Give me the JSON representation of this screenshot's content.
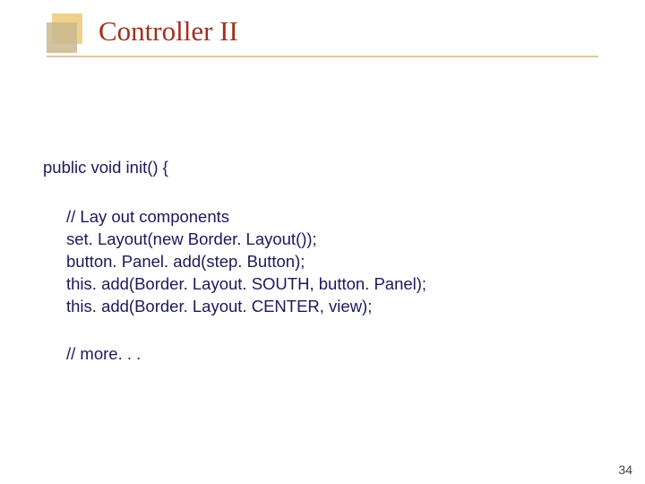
{
  "title": "Controller II",
  "code": {
    "signature": "public void init() {",
    "comment1": "// Lay out components",
    "line1": "set. Layout(new Border. Layout());",
    "line2": "button. Panel. add(step. Button);",
    "line3": "this. add(Border. Layout. SOUTH, button. Panel);",
    "line4": "this. add(Border. Layout. CENTER, view);",
    "comment2": "// more. . ."
  },
  "page_number": "34"
}
